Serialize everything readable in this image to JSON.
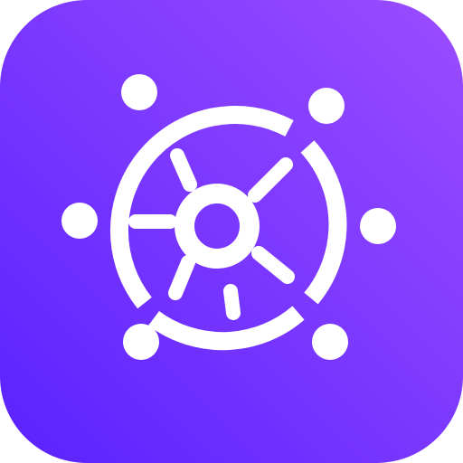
{
  "icon": {
    "name": "ship-wheel-icon",
    "colors": {
      "gradient_start": "#5a22ff",
      "gradient_end": "#9b4dff",
      "glyph": "#ffffff"
    }
  }
}
